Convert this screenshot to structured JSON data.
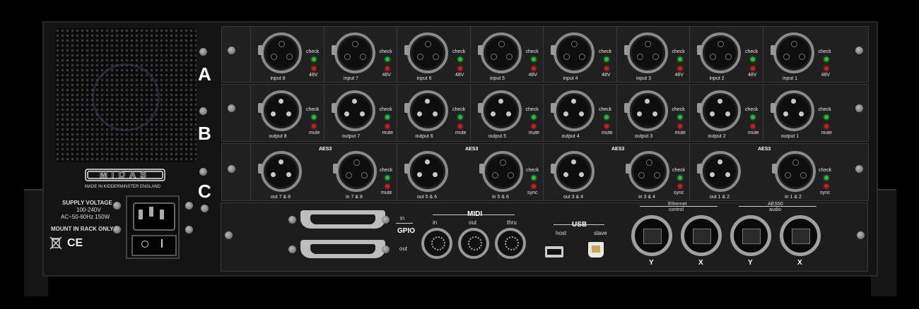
{
  "brand": {
    "logo": "MIDAS",
    "made_in": "MADE IN KIDDERMINSTER ENGLAND"
  },
  "power": {
    "supply_title": "SUPPLY VOLTAGE",
    "voltage": "100-240V",
    "spec": "AC~50-60Hz 150W",
    "mount_note": "MOUNT IN RACK ONLY",
    "ce_mark": "CE",
    "weee_icon": "crossed-bin-icon"
  },
  "row_letters": [
    "A",
    "B",
    "C"
  ],
  "row_a": {
    "cards": [
      {
        "label": "input 8",
        "check": "check",
        "phantom": "48V"
      },
      {
        "label": "input 7",
        "check": "check",
        "phantom": "48V"
      },
      {
        "label": "input 6",
        "check": "check",
        "phantom": "48V"
      },
      {
        "label": "input 5",
        "check": "check",
        "phantom": "48V"
      },
      {
        "label": "input 4",
        "check": "check",
        "phantom": "48V"
      },
      {
        "label": "input 3",
        "check": "check",
        "phantom": "48V"
      },
      {
        "label": "input 2",
        "check": "check",
        "phantom": "48V"
      },
      {
        "label": "input 1",
        "check": "check",
        "phantom": "48V"
      }
    ]
  },
  "row_b": {
    "cards": [
      {
        "label": "output 8",
        "check": "check",
        "mute": "mute"
      },
      {
        "label": "output 7",
        "check": "check",
        "mute": "mute"
      },
      {
        "label": "output 6",
        "check": "check",
        "mute": "mute"
      },
      {
        "label": "output 5",
        "check": "check",
        "mute": "mute"
      },
      {
        "label": "output 4",
        "check": "check",
        "mute": "mute"
      },
      {
        "label": "output 3",
        "check": "check",
        "mute": "mute"
      },
      {
        "label": "output 2",
        "check": "check",
        "mute": "mute"
      },
      {
        "label": "output 1",
        "check": "check",
        "mute": "mute"
      }
    ]
  },
  "row_c": {
    "aes_label": "AES3",
    "cards": [
      {
        "left_label": "out 7 & 8",
        "right_label": "in 7 & 8",
        "check": "check",
        "status": "mute"
      },
      {
        "left_label": "out 5 & 6",
        "right_label": "in 5 & 6",
        "check": "check",
        "status": "sync"
      },
      {
        "left_label": "out 3 & 4",
        "right_label": "in 3 & 4",
        "check": "check",
        "status": "sync"
      },
      {
        "left_label": "out 1 & 2",
        "right_label": "in 1 & 2",
        "check": "check",
        "status": "sync"
      }
    ]
  },
  "io": {
    "gpio": {
      "title": "GPIO",
      "in": "in",
      "out": "out"
    },
    "midi": {
      "title": "MIDI",
      "ports": [
        "in",
        "out",
        "thru"
      ]
    },
    "usb": {
      "title": "USB",
      "host": "host",
      "slave": "slave"
    },
    "ethernet": {
      "title": "Ethernet",
      "subtitle": "control",
      "ports": [
        "Y",
        "X"
      ]
    },
    "aes50": {
      "title": "AES50",
      "subtitle": "audio",
      "ports": [
        "Y",
        "X"
      ]
    }
  },
  "colors": {
    "led_green": "#1fbf3a",
    "led_red": "#c81d1d",
    "chassis": "#141414"
  }
}
